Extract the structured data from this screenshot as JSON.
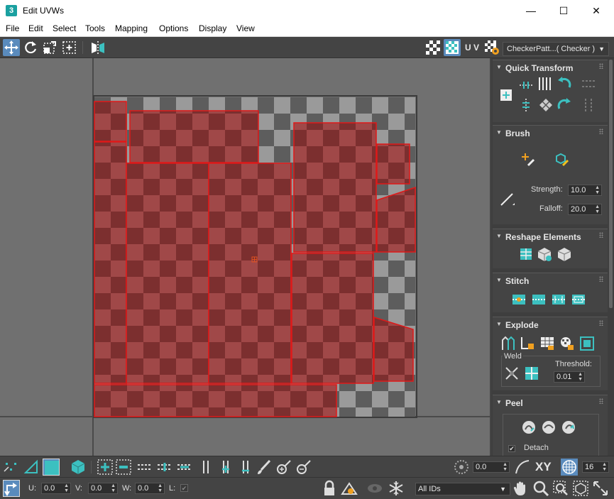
{
  "window": {
    "title": "Edit UVWs",
    "app_icon_text": "3",
    "minimize": "—",
    "maximize": "☐",
    "close": "✕"
  },
  "menu": [
    "File",
    "Edit",
    "Select",
    "Tools",
    "Mapping",
    "Options",
    "Display",
    "View"
  ],
  "toolbar": {
    "uv_label": "U V",
    "texture_dropdown": "CheckerPatt...( Checker )"
  },
  "panel": {
    "quick_transform": {
      "title": "Quick Transform"
    },
    "brush": {
      "title": "Brush",
      "strength_label": "Strength:",
      "strength_value": "10.0",
      "falloff_label": "Falloff:",
      "falloff_value": "20.0"
    },
    "reshape": {
      "title": "Reshape Elements"
    },
    "stitch": {
      "title": "Stitch"
    },
    "explode": {
      "title": "Explode",
      "weld_label": "Weld",
      "threshold_label": "Threshold:",
      "threshold_value": "0.01"
    },
    "peel": {
      "title": "Peel",
      "detach_label": "Detach"
    }
  },
  "bottom1": {
    "angle_value": "0.0",
    "xy_label": "XY",
    "grid_value": "16"
  },
  "bottom2": {
    "u_label": "U:",
    "u_value": "0.0",
    "v_label": "V:",
    "v_value": "0.0",
    "w_label": "W:",
    "w_value": "0.0",
    "l_label": "L:",
    "ids_dropdown": "All IDs"
  },
  "colors": {
    "accent": "#5a8bbd",
    "teal": "#3cc0c0",
    "selection_red": "#e01818",
    "panel_bg": "#444444"
  }
}
